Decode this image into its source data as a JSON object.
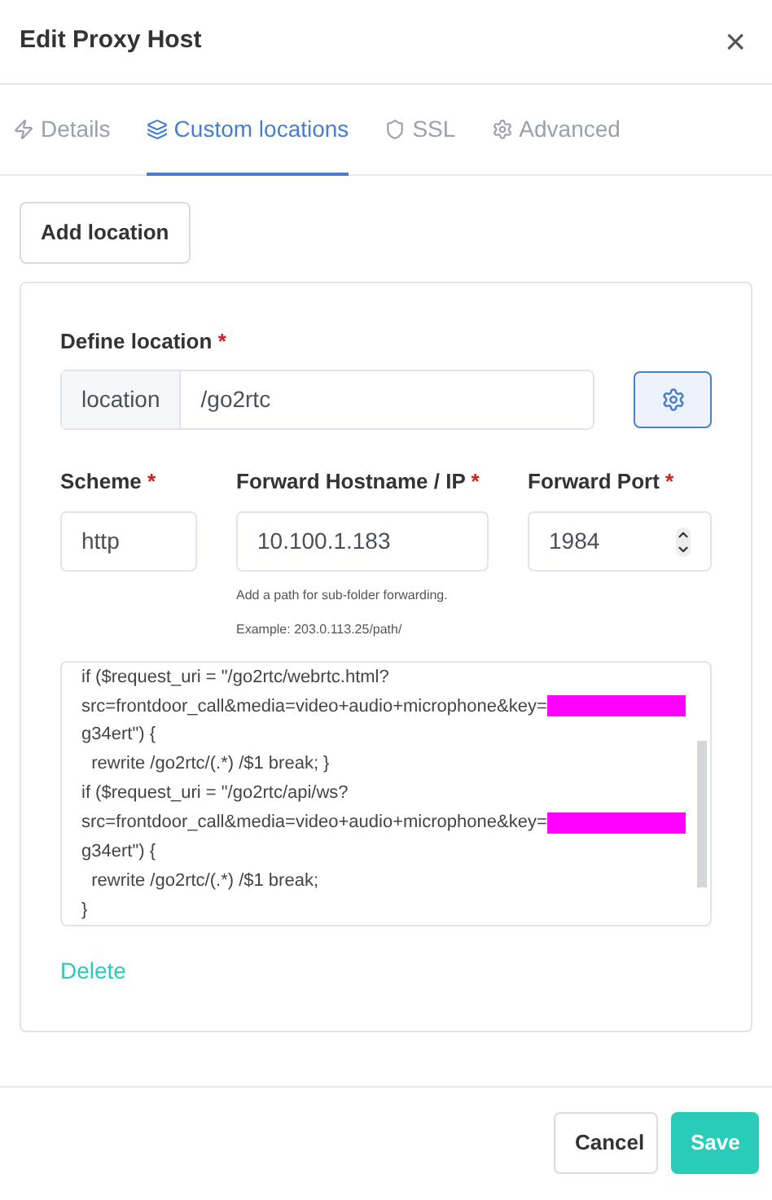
{
  "dialog": {
    "title": "Edit Proxy Host",
    "close": "×"
  },
  "tabs": [
    {
      "label": "Details",
      "selected": false
    },
    {
      "label": "Custom locations",
      "selected": true
    },
    {
      "label": "SSL",
      "selected": false
    },
    {
      "label": "Advanced",
      "selected": false
    }
  ],
  "add_button": "Add location",
  "location": {
    "label": "Define location",
    "required": "*",
    "prefix": "location",
    "value": "/go2rtc"
  },
  "fields": [
    {
      "label": "Scheme",
      "required": "*",
      "value": "http",
      "kind": "text"
    },
    {
      "label": "Forward Hostname / IP",
      "required": "*",
      "value": "10.100.1.183",
      "kind": "text",
      "hints": [
        "Add a path for sub-folder forwarding.",
        "Example: 203.0.113.25/path/"
      ]
    },
    {
      "label": "Forward Port",
      "required": "*",
      "value": "1984",
      "kind": "number"
    }
  ],
  "config_lines": [
    {
      "text": "if ($request_uri = \"/go2rtc/webrtc.html?",
      "redacted": false
    },
    {
      "text": "src=frontdoor_call&media=video+audio+microphone&key=",
      "redacted": true
    },
    {
      "text": "g34ert\") {",
      "redacted": false
    },
    {
      "text": "  rewrite /go2rtc/(.*) /$1 break; }",
      "redacted": false
    },
    {
      "text": "if ($request_uri = \"/go2rtc/api/ws?",
      "redacted": false
    },
    {
      "text": "src=frontdoor_call&media=video+audio+microphone&key=",
      "redacted": true
    },
    {
      "text": "g34ert\") {",
      "redacted": false
    },
    {
      "text": "  rewrite /go2rtc/(.*) /$1 break;",
      "redacted": false
    },
    {
      "text": "}",
      "redacted": false
    }
  ],
  "delete_link": "Delete",
  "buttons": [
    {
      "label": "Cancel",
      "kind": "secondary"
    },
    {
      "label": "Save",
      "kind": "primary"
    }
  ]
}
